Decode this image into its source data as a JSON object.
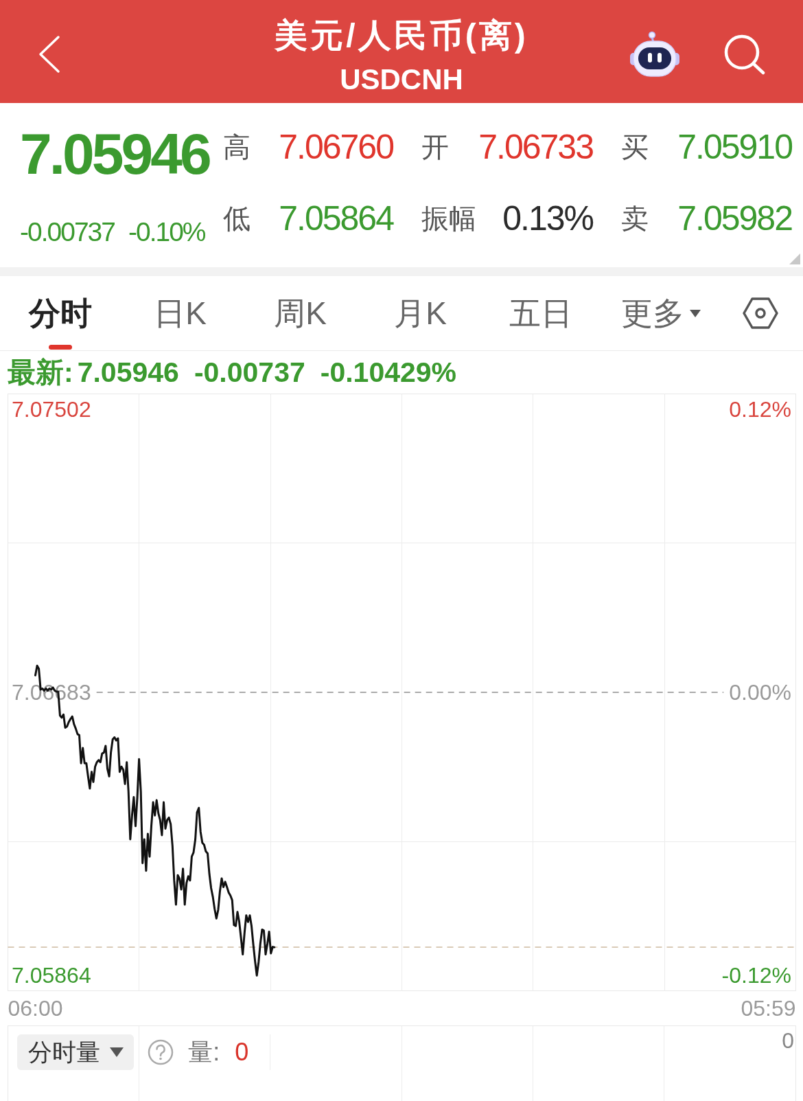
{
  "header": {
    "title": "美元/人民币(离)",
    "subtitle": "USDCNH"
  },
  "quote": {
    "price": "7.05946",
    "change": "-0.00737",
    "change_pct": "-0.10%",
    "falling": true,
    "stats": [
      {
        "label": "高",
        "value": "7.06760",
        "color": "#e0352c"
      },
      {
        "label": "开",
        "value": "7.06733",
        "color": "#e0352c"
      },
      {
        "label": "买",
        "value": "7.05910",
        "color": "#3b9a2f"
      },
      {
        "label": "低",
        "value": "7.05864",
        "color": "#3b9a2f"
      },
      {
        "label": "振幅",
        "value": "0.13%",
        "color": "#2b2b2b"
      },
      {
        "label": "卖",
        "value": "7.05982",
        "color": "#3b9a2f"
      }
    ]
  },
  "tabs": [
    {
      "label": "分时",
      "selected": true,
      "kind": "view"
    },
    {
      "label": "日K",
      "selected": false,
      "kind": "view"
    },
    {
      "label": "周K",
      "selected": false,
      "kind": "view"
    },
    {
      "label": "月K",
      "selected": false,
      "kind": "view"
    },
    {
      "label": "五日",
      "selected": false,
      "kind": "view"
    },
    {
      "label": "更多",
      "selected": false,
      "kind": "menu"
    }
  ],
  "latest": {
    "label": "最新:",
    "price": "7.05946",
    "change": "-0.00737",
    "change_pct": "-0.10429%",
    "falling": true
  },
  "chart": {
    "chart_data": {
      "type": "line",
      "categories": [
        "06:00",
        null,
        null,
        null,
        null,
        null,
        null,
        null,
        null,
        null,
        null,
        null,
        null,
        null,
        null,
        null,
        null,
        null,
        null,
        null,
        null,
        null,
        null,
        null,
        null,
        null,
        null,
        null,
        null,
        null,
        null,
        null,
        null,
        null,
        null,
        null,
        null,
        null,
        null,
        null,
        null,
        null,
        null,
        null,
        null,
        null,
        null,
        null,
        null,
        null,
        null,
        null,
        null,
        null,
        null,
        null,
        null,
        null,
        null,
        null,
        null,
        null,
        null,
        null,
        null,
        null,
        null,
        null,
        null,
        null,
        null,
        null,
        null,
        null,
        null,
        null,
        null,
        null,
        null,
        null,
        null,
        null,
        null,
        null,
        null,
        null,
        null,
        null,
        null,
        null,
        null,
        null,
        null,
        null,
        null,
        null,
        null,
        null,
        null,
        null,
        null,
        null,
        null,
        null,
        null,
        null,
        null,
        null,
        null,
        null,
        null,
        null,
        null,
        null,
        null,
        null,
        null,
        null,
        null,
        null,
        null,
        null,
        null,
        null,
        null,
        null,
        null,
        null,
        null,
        null,
        null,
        null,
        null,
        null,
        null,
        null,
        null,
        null,
        null,
        null,
        null,
        null,
        null,
        null,
        null,
        null,
        null,
        null,
        null,
        null,
        null,
        null,
        null,
        null,
        null,
        null,
        null,
        null,
        null,
        null,
        null,
        null,
        null,
        null,
        null,
        null,
        null,
        null,
        null,
        null,
        null,
        null,
        null,
        null,
        null,
        null,
        null,
        null,
        null,
        null,
        null,
        null,
        null,
        null,
        null,
        null,
        null,
        null,
        null,
        null,
        null,
        null,
        null,
        null,
        null,
        null,
        null,
        null,
        null,
        null,
        null,
        null,
        null,
        null,
        null,
        null,
        null,
        null,
        null,
        null,
        null,
        null,
        null,
        null,
        null,
        null,
        null,
        null,
        null,
        null,
        null,
        null,
        null,
        null,
        null,
        null,
        null,
        null,
        null,
        null,
        null,
        null,
        null,
        null,
        null,
        null,
        null,
        null,
        null,
        null,
        null,
        null,
        null,
        null,
        null,
        null,
        null,
        null,
        null,
        null,
        null,
        null,
        null,
        null,
        null,
        null,
        null,
        null,
        null,
        null,
        null,
        null,
        null,
        null,
        null,
        null,
        null,
        null,
        null,
        null,
        null,
        null,
        null,
        null,
        null,
        null,
        null,
        null,
        null,
        null,
        null,
        null,
        null,
        null,
        null,
        null,
        null,
        null,
        null,
        null,
        null,
        null,
        null,
        null,
        null,
        null,
        null,
        null,
        null,
        null,
        null,
        null,
        null,
        null,
        null,
        null,
        null,
        null,
        null,
        null,
        null,
        null,
        null,
        null,
        null,
        null,
        null,
        null,
        null,
        null,
        null,
        null,
        null,
        null,
        null,
        null,
        null,
        null,
        null,
        null,
        null,
        null,
        null,
        null,
        null,
        null,
        null,
        null,
        null,
        null,
        null,
        null,
        null,
        null,
        null,
        null,
        null,
        null,
        null,
        null,
        null,
        null,
        null,
        null,
        null,
        null,
        null,
        null,
        null,
        null,
        null,
        null,
        null,
        null,
        null,
        null,
        null,
        null,
        null,
        null,
        null,
        null,
        null,
        null,
        null,
        null,
        null,
        null,
        null,
        null,
        null,
        null,
        null,
        null,
        null,
        null,
        null,
        null,
        null,
        null,
        null,
        null,
        null,
        null,
        null,
        null,
        null,
        null,
        null,
        null,
        null,
        null,
        null,
        null,
        null,
        null,
        null,
        null,
        null,
        null,
        null,
        null,
        null,
        null,
        null,
        null,
        null,
        "05:59"
      ],
      "series": [
        {
          "color": "#111111",
          "values": [
            7.06732,
            7.0676,
            7.06751,
            7.06691,
            7.06694,
            7.06688,
            7.06694,
            7.06688,
            7.06694,
            7.06691,
            7.06697,
            7.06688,
            7.06685,
            7.06685,
            7.06616,
            7.0661,
            7.06619,
            7.06581,
            7.06584,
            7.06597,
            7.06606,
            7.06613,
            7.06591,
            7.06578,
            7.06562,
            7.06559,
            7.06478,
            7.06522,
            7.06478,
            7.06478,
            7.0644,
            7.06405,
            7.06453,
            7.06424,
            7.06468,
            7.06481,
            7.06487,
            7.06481,
            7.06506,
            7.06509,
            7.06528,
            7.06462,
            7.0644,
            7.06509,
            7.06547,
            7.06553,
            7.06544,
            7.0655,
            7.06453,
            7.06468,
            7.06459,
            7.06418,
            7.06481,
            7.06396,
            7.06258,
            7.06327,
            7.0638,
            7.06296,
            7.06377,
            7.0649,
            7.06396,
            7.06189,
            7.06258,
            7.06167,
            7.06274,
            7.06208,
            7.06296,
            7.06365,
            7.06327,
            7.06371,
            7.06333,
            7.06314,
            7.0627,
            7.06365,
            7.06289,
            7.06314,
            7.06321,
            7.06302,
            7.06239,
            7.06139,
            7.06069,
            7.06154,
            7.06145,
            7.06113,
            7.06173,
            7.06069,
            7.06132,
            7.06151,
            7.06139,
            7.06208,
            7.0622,
            7.06258,
            7.06336,
            7.06349,
            7.0628,
            7.06248,
            7.06242,
            7.06223,
            7.06217,
            7.06157,
            7.06117,
            7.06091,
            7.06057,
            7.06029,
            7.06054,
            7.06107,
            7.06145,
            7.0612,
            7.06135,
            7.0612,
            7.06104,
            7.06095,
            7.06082,
            7.0601,
            7.06007,
            7.06048,
            7.06019,
            7.05972,
            7.05925,
            7.05988,
            7.06038,
            7.06019,
            7.06038,
            7.06007,
            7.05953,
            7.05906,
            7.05864,
            7.05903,
            7.05956,
            7.05997,
            7.05994,
            7.05925,
            7.05956,
            7.05991,
            7.05928,
            7.05947,
            7.05946,
            null,
            null,
            null,
            null,
            null,
            null,
            null,
            null,
            null,
            null,
            null,
            null,
            null,
            null,
            null,
            null,
            null,
            null,
            null,
            null,
            null,
            null,
            null,
            null,
            null,
            null,
            null,
            null,
            null,
            null,
            null,
            null,
            null,
            null,
            null,
            null,
            null,
            null,
            null,
            null,
            null,
            null,
            null,
            null,
            null,
            null,
            null,
            null,
            null,
            null,
            null,
            null,
            null,
            null,
            null,
            null,
            null,
            null,
            null,
            null,
            null,
            null,
            null,
            null,
            null,
            null,
            null,
            null,
            null,
            null,
            null,
            null,
            null,
            null,
            null,
            null,
            null,
            null,
            null,
            null,
            null,
            null,
            null,
            null,
            null,
            null,
            null,
            null,
            null,
            null,
            null,
            null,
            null,
            null,
            null,
            null,
            null,
            null,
            null,
            null,
            null,
            null,
            null,
            null,
            null,
            null,
            null,
            null,
            null,
            null,
            null,
            null,
            null,
            null,
            null,
            null,
            null,
            null,
            null,
            null,
            null,
            null,
            null,
            null,
            null,
            null,
            null,
            null,
            null,
            null,
            null,
            null,
            null,
            null,
            null,
            null,
            null,
            null,
            null,
            null,
            null,
            null,
            null,
            null,
            null,
            null,
            null,
            null,
            null,
            null,
            null,
            null,
            null,
            null,
            null,
            null,
            null,
            null,
            null,
            null,
            null,
            null,
            null,
            null,
            null,
            null,
            null,
            null,
            null,
            null,
            null,
            null,
            null,
            null,
            null,
            null,
            null,
            null,
            null,
            null,
            null,
            null,
            null,
            null,
            null,
            null,
            null,
            null,
            null,
            null,
            null,
            null,
            null,
            null,
            null,
            null,
            null,
            null,
            null,
            null,
            null,
            null,
            null,
            null,
            null,
            null,
            null,
            null,
            null,
            null,
            null,
            null,
            null,
            null,
            null,
            null,
            null,
            null,
            null,
            null,
            null,
            null,
            null,
            null,
            null,
            null,
            null,
            null,
            null,
            null,
            null,
            null,
            null,
            null,
            null,
            null,
            null,
            null,
            null,
            null,
            null,
            null,
            null,
            null,
            null,
            null,
            null,
            null,
            null,
            null,
            null,
            null,
            null,
            null,
            null,
            null,
            null,
            null,
            null,
            null,
            null,
            null,
            null,
            null,
            null,
            null,
            null,
            null,
            null,
            null,
            null,
            null,
            null,
            null,
            null,
            null,
            null,
            null,
            null,
            null,
            null
          ]
        }
      ],
      "ylim": [
        7.0582,
        7.07546
      ],
      "yticks": [
        {
          "value": 7.07502,
          "label": "7.07502"
        },
        {
          "value": 7.06683,
          "label": "7.06683"
        },
        {
          "value": 7.05864,
          "label": "7.05864"
        }
      ],
      "ref_lines": [
        {
          "axis": "y",
          "value": 7.06683,
          "color": "#8f8f8f"
        },
        {
          "axis": "y",
          "value": 7.05946,
          "color": "#cdb9a0"
        }
      ]
    },
    "right_axis": [
      {
        "label": "0.12%",
        "color": "#d9463f"
      },
      {
        "label": "0.00%",
        "color": "#9a9a9a"
      },
      {
        "label": "-0.12%",
        "color": "#3b9a2f"
      }
    ]
  },
  "volume": {
    "selector": "分时量",
    "label": "量:",
    "value": "0",
    "axis_label": "0"
  }
}
